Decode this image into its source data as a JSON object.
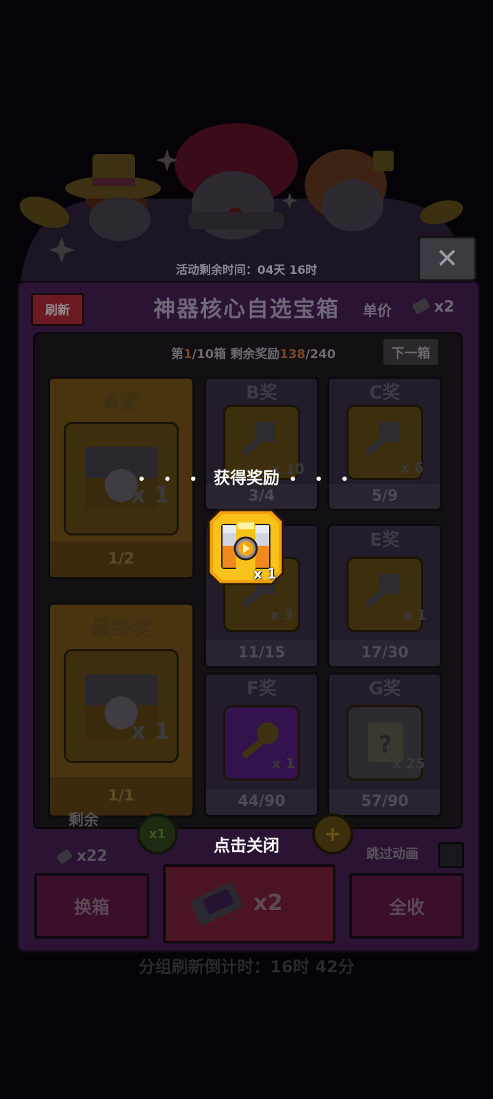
{
  "header": {
    "event_time_remaining": "活动剩余时间：04天 16时",
    "close_icon": "close-x-icon"
  },
  "panel": {
    "refresh_label": "刷新",
    "title": "神器核心自选宝箱",
    "unit_price_label": "单价",
    "unit_price_icon": "ticket-icon",
    "unit_price_count": "x2",
    "progress_prefix": "第",
    "progress_current_box": "1",
    "progress_box_rest": "/10箱  剩余奖励",
    "progress_remaining": "138",
    "progress_total": "/240",
    "next_box_label": "下一箱"
  },
  "prizes": [
    {
      "id": "A",
      "title": "A奖",
      "qty": "x 1",
      "count": "1/2",
      "icon": "artifact-core-chest-icon"
    },
    {
      "id": "B",
      "title": "B奖",
      "qty": "x 10",
      "count": "3/4",
      "icon": "silver-key-icon"
    },
    {
      "id": "C",
      "title": "C奖",
      "qty": "x 6",
      "count": "5/9",
      "icon": "silver-key-icon"
    },
    {
      "id": "D",
      "title": "",
      "qty": "x 3",
      "count": "11/15",
      "icon": "silver-key-icon"
    },
    {
      "id": "E",
      "title": "E奖",
      "qty": "x 1",
      "count": "17/30",
      "icon": "silver-key-icon"
    },
    {
      "id": "final",
      "title": "最终奖",
      "qty": "x 1",
      "count": "1/1",
      "icon": "artifact-core-chest-icon"
    },
    {
      "id": "F",
      "title": "F奖",
      "qty": "x 1",
      "count": "44/90",
      "icon": "gold-key-icon"
    },
    {
      "id": "G",
      "title": "G奖",
      "qty": "x 25",
      "count": "57/90",
      "icon": "mystery-scroll-icon"
    }
  ],
  "bottom": {
    "remaining_label": "剩余",
    "remaining_count": "x22",
    "multiplier": "x1",
    "plus_icon": "plus-icon",
    "skip_animation_label": "跳过动画",
    "swap_box_label": "换箱",
    "draw_cost": "x2",
    "collect_all_label": "全收",
    "refresh_countdown": "分组刷新倒计时：16时 42分"
  },
  "overlay": {
    "dots": "• • •",
    "reward_title": "获得奖励",
    "reward_qty": "x 1",
    "reward_icon": "artifact-core-chest-icon",
    "tap_to_close": "点击关闭"
  },
  "colors": {
    "background": "#050307",
    "panel": "#2b1433",
    "reward_gold": "#f7b90f",
    "reward_orange": "#f28a1c"
  }
}
